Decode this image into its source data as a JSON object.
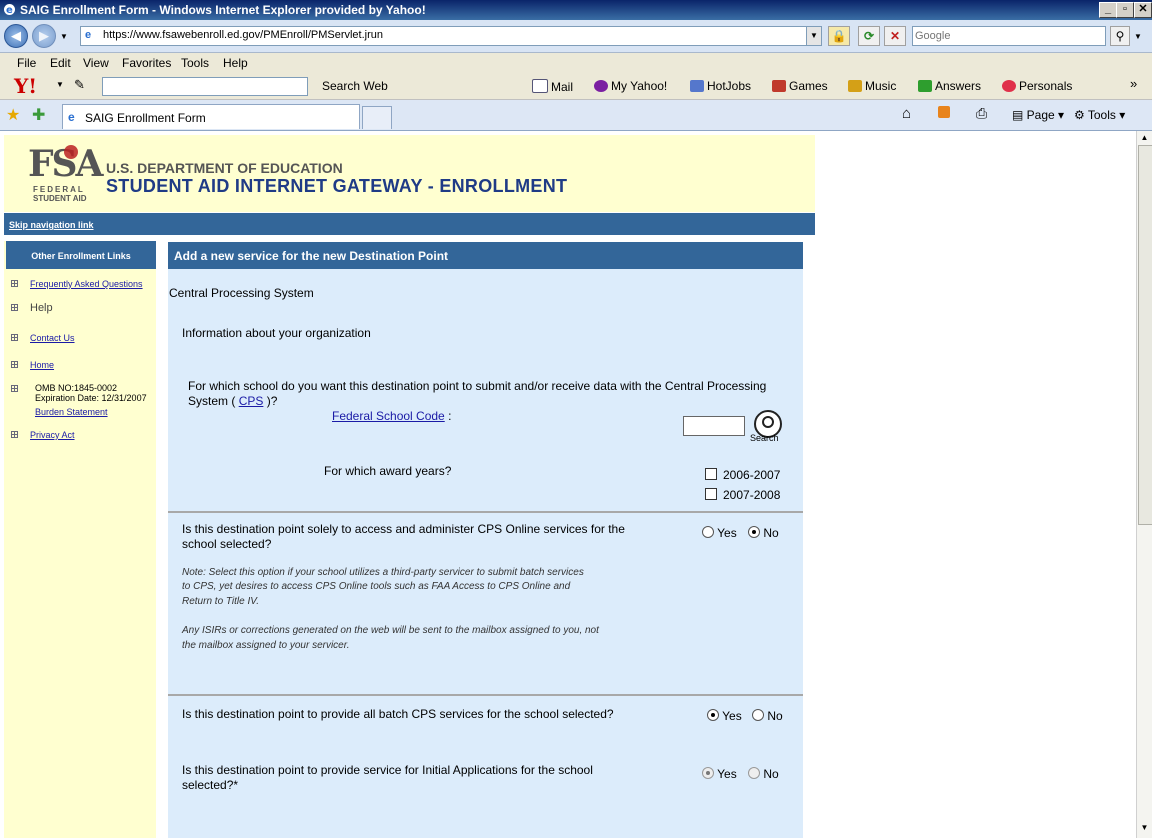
{
  "window": {
    "title": "SAIG Enrollment Form - Windows Internet Explorer provided by Yahoo!",
    "url": "https://www.fsawebenroll.ed.gov/PMEnroll/PMServlet.jrun",
    "search_placeholder": "Google",
    "controls": {
      "min": "_",
      "max": "▫",
      "close": "✕"
    }
  },
  "menu": [
    "File",
    "Edit",
    "View",
    "Favorites",
    "Tools",
    "Help"
  ],
  "yahoo_toolbar": {
    "search_web": "Search Web",
    "items": [
      "Mail",
      "My Yahoo!",
      "HotJobs",
      "Games",
      "Music",
      "Answers",
      "Personals"
    ],
    "more": "»"
  },
  "tabs": {
    "active": "SAIG Enrollment Form",
    "commands": {
      "page": "Page",
      "tools": "Tools"
    }
  },
  "header": {
    "logo_text": "FSA",
    "logo_sub1": "FEDERAL",
    "logo_sub2": "STUDENT AID",
    "dept": "U.S. DEPARTMENT OF EDUCATION",
    "gateway": "STUDENT AID INTERNET GATEWAY - ENROLLMENT",
    "skip": "Skip navigation link"
  },
  "sidebar": {
    "title": "Other Enrollment Links",
    "faq": "Frequently Asked Questions",
    "help": "Help",
    "contact": "Contact Us",
    "home": "Home",
    "omb": "OMB NO:1845-0002",
    "expiration": "Expiration Date: 12/31/2007",
    "burden": "Burden Statement",
    "privacy": "Privacy Act"
  },
  "main": {
    "heading": "Add a new service for the new Destination Point",
    "section": "Central Processing System",
    "subsection": "Information about your organization",
    "q_school_1": "For which school do you want this destination point to submit and/or receive data with the Central Processing",
    "q_school_2a": "System (",
    "q_school_cps": "CPS",
    "q_school_2b": ")?",
    "fsc_label": "Federal School Code",
    "fsc_colon": ":",
    "fsc_value": "",
    "search_label": "Search",
    "q_years": "For which award years?",
    "year_1": "2006-2007",
    "year_2": "2007-2008",
    "q_online_1": "Is this destination point solely to access and administer CPS Online services for the",
    "q_online_2": "school selected?",
    "note_1": "Note: Select this option if your school utilizes a third-party servicer to submit batch services",
    "note_2": "to CPS, yet desires to access CPS Online tools such as FAA Access to CPS Online and",
    "note_3": "Return to Title IV.",
    "note_4": "Any ISIRs or corrections generated on the web will be sent to the mailbox assigned to you, not",
    "note_5": "the mailbox assigned to your servicer.",
    "q_batch": "Is this destination point to provide all batch CPS services for the school selected?",
    "q_initial_1": "Is this destination point to provide service for Initial Applications for the school",
    "q_initial_2": "selected?*",
    "yes": "Yes",
    "no": "No"
  }
}
